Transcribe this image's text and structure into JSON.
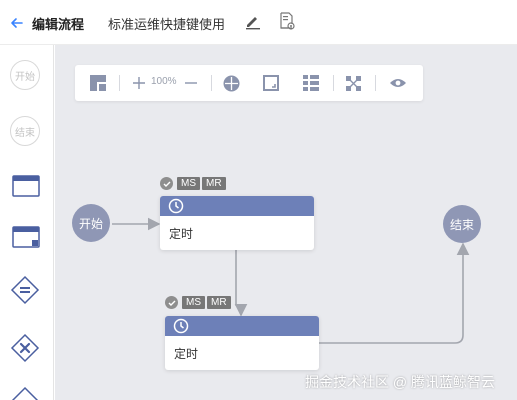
{
  "header": {
    "back_label": "编辑流程",
    "flow_name": "标准运维快捷键使用"
  },
  "palette": {
    "start_label": "开始",
    "end_label": "结束"
  },
  "toolbar": {
    "zoom": "100%"
  },
  "canvas": {
    "start_node": "开始",
    "end_node": "结束",
    "tasks": [
      {
        "label": "定时",
        "tags": [
          "MS",
          "MR"
        ]
      },
      {
        "label": "定时",
        "tags": [
          "MS",
          "MR"
        ]
      }
    ]
  },
  "watermark": "掘金技术社区 @ 腾讯蓝鲸智云",
  "colors": {
    "accent": "#3a84ff",
    "node_fill": "#8f97b5",
    "task_header": "#6d80b8",
    "canvas_bg": "#e9eaee"
  }
}
